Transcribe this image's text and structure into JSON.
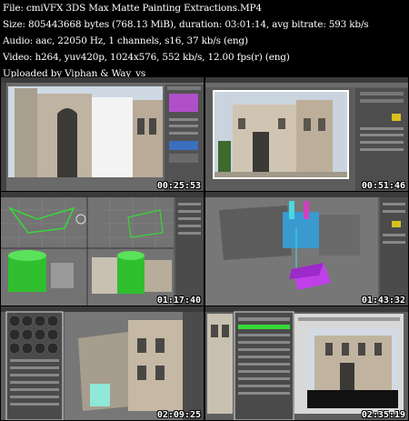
{
  "header": {
    "file": "File: cmiVFX 3DS Max Matte Painting Extractions.MP4",
    "size": "Size: 805443668 bytes (768.13 MiB), duration: 03:01:14, avg bitrate: 593 kb/s",
    "audio": "Audio: aac, 22050 Hz, 1 channels, s16, 37 kb/s (eng)",
    "video": "Video: h264, yuv420p, 1024x576, 552 kb/s, 12.00 fps(r) (eng)",
    "uploader": "Uploaded by Viphan & Way_vs"
  },
  "thumbnails": [
    {
      "timestamp": "00:25:53"
    },
    {
      "timestamp": "00:51:46"
    },
    {
      "timestamp": "01:17:40"
    },
    {
      "timestamp": "01:43:32"
    },
    {
      "timestamp": "02:09:25"
    },
    {
      "timestamp": "02:35:19"
    }
  ],
  "colors": {
    "background": "#000000",
    "ui_gray": "#5a5a5a",
    "wireframe_green": "#38d838",
    "cyan_object": "#4ad8e0",
    "magenta_object": "#c040e8",
    "sky": "#c9d4de"
  }
}
